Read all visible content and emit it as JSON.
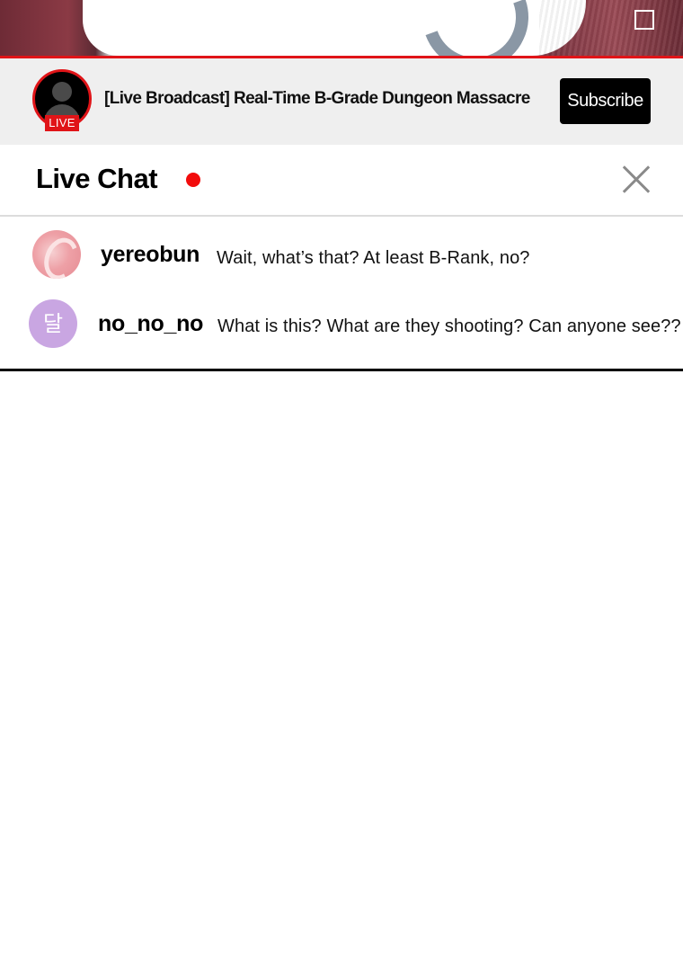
{
  "video": {
    "fullscreen_icon": "fullscreen-icon"
  },
  "channel": {
    "live_badge": "LIVE",
    "title": "[Live Broadcast] Real-Time B-Grade Dungeon Massacre",
    "subscribe_label": "Subscribe",
    "accent_color": "#e01418"
  },
  "chat": {
    "title": "Live Chat",
    "live_dot_color": "#f20c0c",
    "close_icon": "close-icon",
    "messages": [
      {
        "username": "yereobun",
        "text": "Wait, what’s that? At least B-Rank, no?",
        "avatar": "pink-swirl-avatar"
      },
      {
        "username": "no_no_no",
        "text": "What is this? What are they shooting? Can anyone see??",
        "avatar_glyph": "달",
        "avatar_color": "#c9a6e2"
      }
    ]
  }
}
